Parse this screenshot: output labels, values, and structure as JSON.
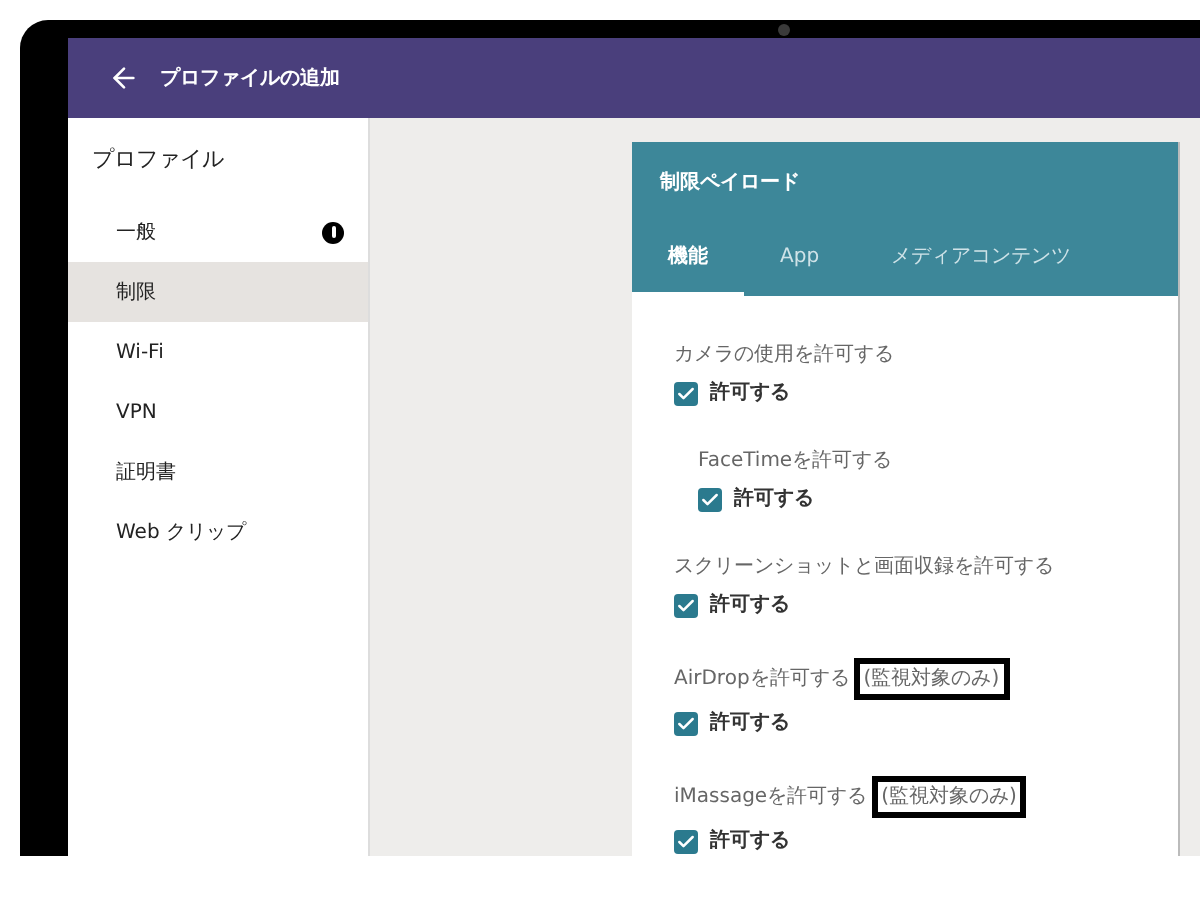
{
  "header": {
    "title": "プロファイルの追加"
  },
  "sidebar": {
    "heading": "プロファイル",
    "items": [
      {
        "label": "一般",
        "selected": false,
        "alert": true
      },
      {
        "label": "制限",
        "selected": true,
        "alert": false
      },
      {
        "label": "Wi-Fi",
        "selected": false,
        "alert": false
      },
      {
        "label": "VPN",
        "selected": false,
        "alert": false
      },
      {
        "label": "証明書",
        "selected": false,
        "alert": false
      },
      {
        "label": "Web クリップ",
        "selected": false,
        "alert": false
      }
    ]
  },
  "card": {
    "title": "制限ペイロード",
    "tabs": [
      {
        "label": "機能",
        "selected": true
      },
      {
        "label": "App",
        "selected": false
      },
      {
        "label": "メディアコンテンツ",
        "selected": false
      }
    ],
    "settings": [
      {
        "kind": "main",
        "label": "カメラの使用を許可する",
        "checkbox": {
          "label": "許可する",
          "checked": true
        }
      },
      {
        "kind": "sub",
        "label": "FaceTimeを許可する",
        "checkbox": {
          "label": "許可する",
          "checked": true
        }
      },
      {
        "kind": "main",
        "label": "スクリーンショットと画面収録を許可する",
        "checkbox": {
          "label": "許可する",
          "checked": true
        }
      },
      {
        "kind": "main",
        "label": "AirDropを許可する",
        "note": "(監視対象のみ)",
        "checkbox": {
          "label": "許可する",
          "checked": true
        }
      },
      {
        "kind": "main",
        "label": "iMassageを許可する",
        "note": "(監視対象のみ)",
        "checkbox": {
          "label": "許可する",
          "checked": true
        }
      }
    ]
  }
}
